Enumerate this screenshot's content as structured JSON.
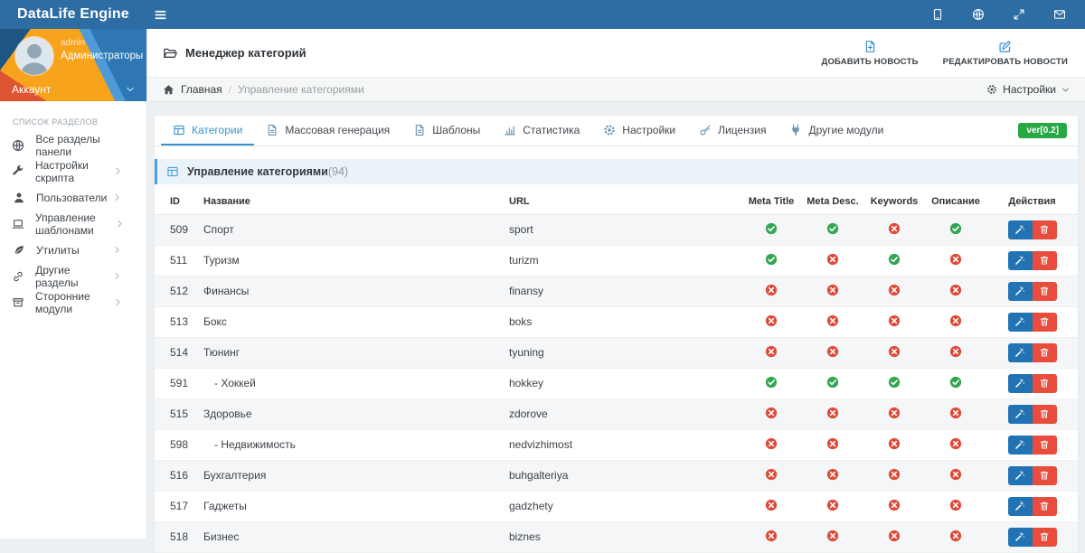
{
  "colors": {
    "topbar": "#2e6da4",
    "accent": "#3a92cd",
    "status_yes": "#33a652",
    "status_no": "#dd4b39",
    "version_badge": "#28a745",
    "edit_button": "#2173b4",
    "delete_button": "#e74c3c"
  },
  "topbar": {
    "brand": "DataLife Engine",
    "icons": [
      {
        "name": "mobile"
      },
      {
        "name": "globe"
      },
      {
        "name": "expand"
      },
      {
        "name": "mail"
      }
    ]
  },
  "sidebar": {
    "user": {
      "name": "admin",
      "role": "Администраторы",
      "account_label": "Аккаунт"
    },
    "section_label": "СПИСОК РАЗДЕЛОВ",
    "items": [
      {
        "label": "Все разделы панели",
        "icon": "globe",
        "slug": "all-sections",
        "expandable": false
      },
      {
        "label": "Настройки скрипта",
        "icon": "wrench",
        "slug": "script-settings",
        "expandable": true
      },
      {
        "label": "Пользователи",
        "icon": "user",
        "slug": "users",
        "expandable": true
      },
      {
        "label": "Управление шаблонами",
        "icon": "laptop",
        "slug": "templates",
        "expandable": true
      },
      {
        "label": "Утилиты",
        "icon": "leaf",
        "slug": "utilities",
        "expandable": true
      },
      {
        "label": "Другие разделы",
        "icon": "link",
        "slug": "other-sections",
        "expandable": true
      },
      {
        "label": "Сторонние модули",
        "icon": "archive",
        "slug": "third-party-modules",
        "expandable": true
      }
    ]
  },
  "header": {
    "title": "Менеджер категорий",
    "actions": [
      {
        "label": "ДОБАВИТЬ НОВОСТЬ",
        "icon": "file-add",
        "slug": "add-news"
      },
      {
        "label": "РЕДАКТИРОВАТЬ НОВОСТИ",
        "icon": "edit-square",
        "slug": "edit-news"
      }
    ]
  },
  "breadcrumb": {
    "home_label": "Главная",
    "separator": "/",
    "current": "Управление категориями",
    "settings_label": "Настройки"
  },
  "tabs": {
    "version_badge": "ver[0.2]",
    "items": [
      {
        "label": "Категории",
        "icon": "table",
        "slug": "categories",
        "active": true
      },
      {
        "label": "Массовая генерация",
        "icon": "file",
        "slug": "mass-generation",
        "active": false
      },
      {
        "label": "Шаблоны",
        "icon": "file",
        "slug": "templates",
        "active": false
      },
      {
        "label": "Статистика",
        "icon": "chart",
        "slug": "statistics",
        "active": false
      },
      {
        "label": "Настройки",
        "icon": "gear",
        "slug": "settings",
        "active": false
      },
      {
        "label": "Лицензия",
        "icon": "key",
        "slug": "license",
        "active": false
      },
      {
        "label": "Другие модули",
        "icon": "plug",
        "slug": "other-modules",
        "active": false
      }
    ]
  },
  "panel": {
    "title": "Управление категориями",
    "count": "(94)"
  },
  "table": {
    "columns": [
      {
        "label": "ID",
        "align": "left"
      },
      {
        "label": "Название",
        "align": "left"
      },
      {
        "label": "URL",
        "align": "left"
      },
      {
        "label": "Meta Title",
        "align": "center"
      },
      {
        "label": "Meta Desc.",
        "align": "center"
      },
      {
        "label": "Keywords",
        "align": "center"
      },
      {
        "label": "Описание",
        "align": "center"
      },
      {
        "label": "Действия",
        "align": "center"
      }
    ],
    "rows": [
      {
        "id": "509",
        "name": "Спорт",
        "indent": false,
        "url": "sport",
        "meta_title": true,
        "meta_desc": true,
        "keywords": false,
        "description": true
      },
      {
        "id": "511",
        "name": "Туризм",
        "indent": false,
        "url": "turizm",
        "meta_title": true,
        "meta_desc": false,
        "keywords": true,
        "description": false
      },
      {
        "id": "512",
        "name": "Финансы",
        "indent": false,
        "url": "finansy",
        "meta_title": false,
        "meta_desc": false,
        "keywords": false,
        "description": false
      },
      {
        "id": "513",
        "name": "Бокс",
        "indent": false,
        "url": "boks",
        "meta_title": false,
        "meta_desc": false,
        "keywords": false,
        "description": false
      },
      {
        "id": "514",
        "name": "Тюнинг",
        "indent": false,
        "url": "tyuning",
        "meta_title": false,
        "meta_desc": false,
        "keywords": false,
        "description": false
      },
      {
        "id": "591",
        "name": "- Хоккей",
        "indent": true,
        "url": "hokkey",
        "meta_title": true,
        "meta_desc": true,
        "keywords": true,
        "description": true
      },
      {
        "id": "515",
        "name": "Здоровье",
        "indent": false,
        "url": "zdorove",
        "meta_title": false,
        "meta_desc": false,
        "keywords": false,
        "description": false
      },
      {
        "id": "598",
        "name": "- Недвижимость",
        "indent": true,
        "url": "nedvizhimost",
        "meta_title": false,
        "meta_desc": false,
        "keywords": false,
        "description": false
      },
      {
        "id": "516",
        "name": "Бухгалтерия",
        "indent": false,
        "url": "buhgalteriya",
        "meta_title": false,
        "meta_desc": false,
        "keywords": false,
        "description": false
      },
      {
        "id": "517",
        "name": "Гаджеты",
        "indent": false,
        "url": "gadzhety",
        "meta_title": false,
        "meta_desc": false,
        "keywords": false,
        "description": false
      },
      {
        "id": "518",
        "name": "Бизнес",
        "indent": false,
        "url": "biznes",
        "meta_title": false,
        "meta_desc": false,
        "keywords": false,
        "description": false
      }
    ]
  }
}
